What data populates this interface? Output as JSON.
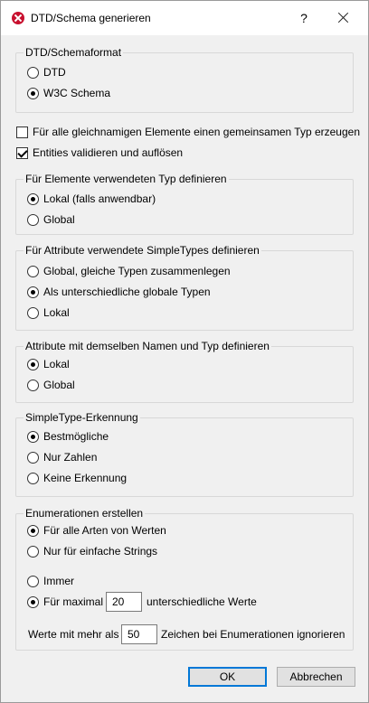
{
  "window": {
    "title": "DTD/Schema generieren",
    "help": "?"
  },
  "format_group": {
    "legend": "DTD/Schemaformat",
    "options": [
      {
        "label": "DTD",
        "selected": false
      },
      {
        "label": "W3C Schema",
        "selected": true
      }
    ]
  },
  "checkboxes": [
    {
      "label": "Für alle gleichnamigen Elemente einen gemeinsamen Typ erzeugen",
      "checked": false
    },
    {
      "label": "Entities validieren und auflösen",
      "checked": true
    }
  ],
  "element_type_group": {
    "legend": "Für Elemente verwendeten Typ definieren",
    "options": [
      {
        "label": "Lokal (falls anwendbar)",
        "selected": true
      },
      {
        "label": "Global",
        "selected": false
      }
    ]
  },
  "simpletypes_group": {
    "legend": "Für Attribute verwendete SimpleTypes definieren",
    "options": [
      {
        "label": "Global, gleiche Typen zusammenlegen",
        "selected": false
      },
      {
        "label": "Als unterschiedliche globale Typen",
        "selected": true
      },
      {
        "label": "Lokal",
        "selected": false
      }
    ]
  },
  "attribute_group": {
    "legend": "Attribute mit demselben Namen und Typ definieren",
    "options": [
      {
        "label": "Lokal",
        "selected": true
      },
      {
        "label": "Global",
        "selected": false
      }
    ]
  },
  "detection_group": {
    "legend": "SimpleType-Erkennung",
    "options": [
      {
        "label": "Bestmögliche",
        "selected": true
      },
      {
        "label": "Nur Zahlen",
        "selected": false
      },
      {
        "label": "Keine Erkennung",
        "selected": false
      }
    ]
  },
  "enum_group": {
    "legend": "Enumerationen erstellen",
    "options": [
      {
        "label": "Für alle Arten von Werten",
        "selected": true
      },
      {
        "label": "Nur für einfache Strings",
        "selected": false
      },
      {
        "label": "Immer",
        "selected": false
      },
      {
        "label": "Für maximal",
        "selected": true
      }
    ],
    "max_value": "20",
    "max_suffix": "unterschiedliche Werte",
    "ignore_prefix": "Werte mit mehr als",
    "ignore_value": "50",
    "ignore_suffix": "Zeichen bei Enumerationen ignorieren"
  },
  "buttons": {
    "ok": "OK",
    "cancel": "Abbrechen"
  }
}
